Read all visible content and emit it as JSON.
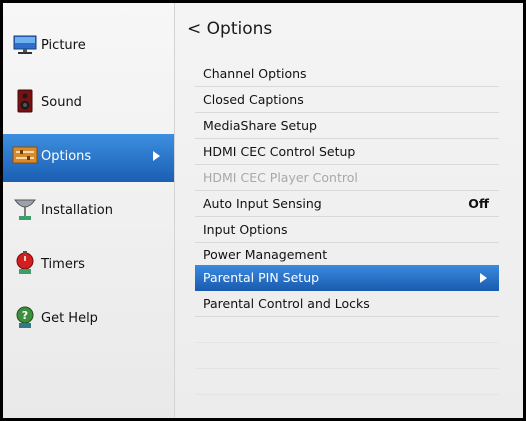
{
  "sidebar": {
    "items": [
      {
        "label": "Picture",
        "icon": "picture-icon"
      },
      {
        "label": "Sound",
        "icon": "speaker-icon"
      },
      {
        "label": "Options",
        "icon": "sliders-icon",
        "selected": true
      },
      {
        "label": "Installation",
        "icon": "satellite-dish-icon"
      },
      {
        "label": "Timers",
        "icon": "timer-icon"
      },
      {
        "label": "Get Help",
        "icon": "help-icon"
      }
    ]
  },
  "panel": {
    "title": "< Options",
    "items": [
      {
        "label": "Channel Options"
      },
      {
        "label": "Closed Captions"
      },
      {
        "label": "MediaShare Setup"
      },
      {
        "label": "HDMI CEC Control Setup"
      },
      {
        "label": "HDMI CEC Player Control",
        "disabled": true
      },
      {
        "label": "Auto Input Sensing",
        "value": "Off"
      },
      {
        "label": "Input Options"
      },
      {
        "label": "Power Management"
      },
      {
        "label": "Parental PIN Setup",
        "selected": true
      },
      {
        "label": "Parental Control and Locks"
      }
    ]
  },
  "colors": {
    "selection_blue": "#1f66be",
    "disabled_text": "#a8a8a8"
  }
}
